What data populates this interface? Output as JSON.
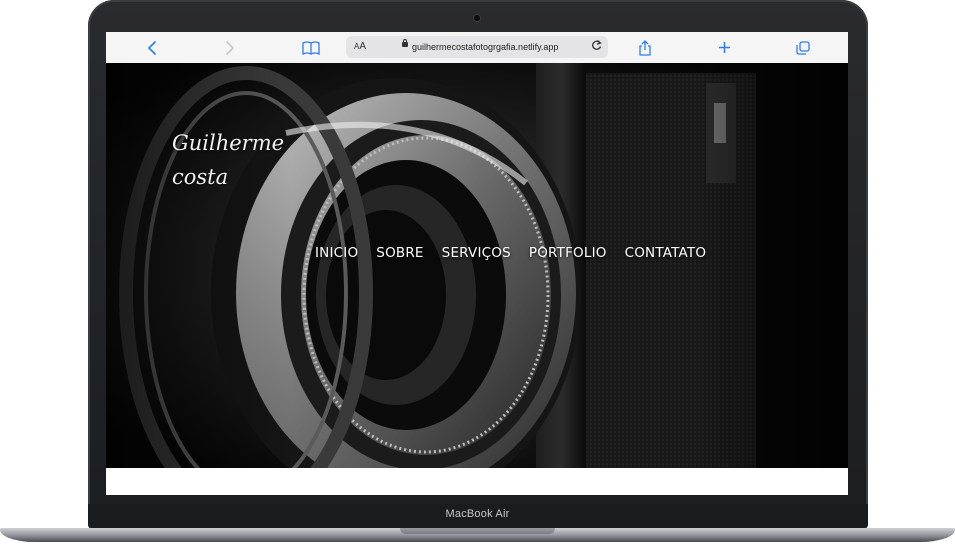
{
  "device": {
    "model_label": "MacBook Air"
  },
  "browser": {
    "text_size_control": {
      "small": "A",
      "large": "A"
    },
    "url": "guilhermecostafotogrgafia.netlify.app",
    "icons": {
      "back": "chevron-left-icon",
      "forward": "chevron-right-icon",
      "bookmarks": "book-icon",
      "reload": "reload-icon",
      "share": "share-icon",
      "new_tab": "plus-icon",
      "tabs": "tabs-icon"
    },
    "accent_color": "#2f7cf6"
  },
  "site": {
    "logo_line1": "Guilherme",
    "logo_line2": "costa",
    "nav": [
      {
        "label": "INICIO"
      },
      {
        "label": "SOBRE"
      },
      {
        "label": "SERVIÇOS"
      },
      {
        "label": "PORTFOLIO"
      },
      {
        "label": "CONTATATO"
      }
    ],
    "hero_image": "camera-lens-photo"
  }
}
